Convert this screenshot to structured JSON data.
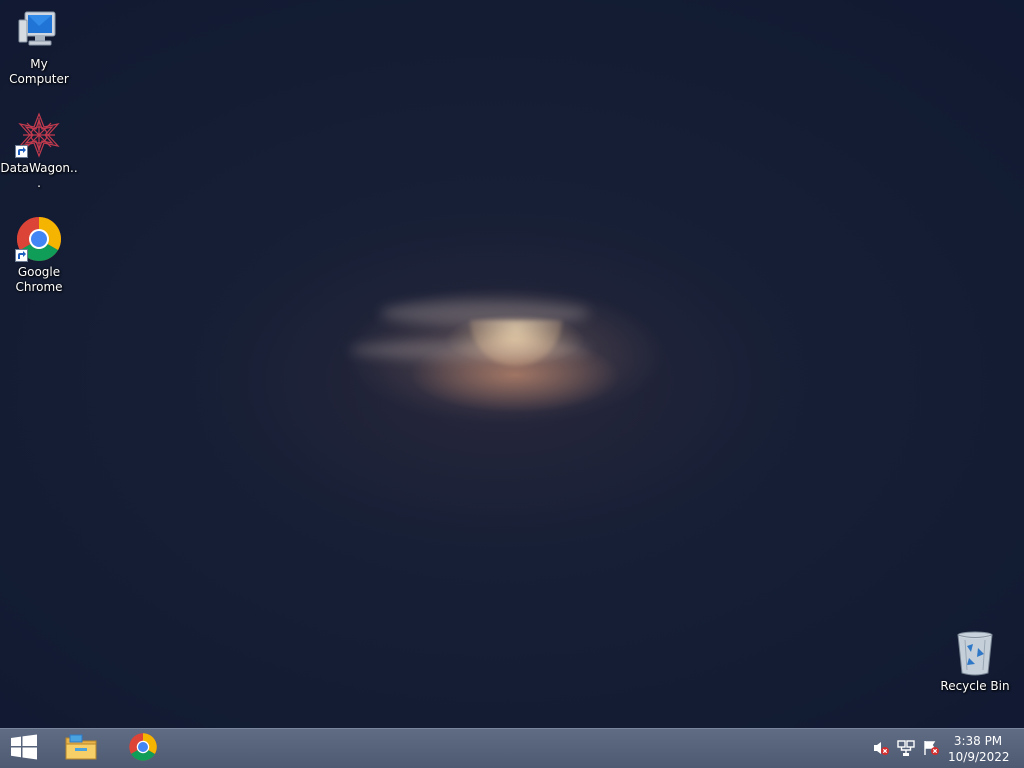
{
  "desktop": {
    "icons": [
      {
        "label": "My Computer",
        "icon": "computer-icon"
      },
      {
        "label": "DataWagon...",
        "icon": "datawagon-icon"
      },
      {
        "label": "Google Chrome",
        "icon": "chrome-icon"
      },
      {
        "label": "Recycle Bin",
        "icon": "recycle-bin-icon"
      }
    ]
  },
  "taskbar": {
    "start_icon": "windows-logo-icon",
    "pinned": [
      {
        "icon": "file-explorer-icon"
      },
      {
        "icon": "chrome-icon"
      }
    ],
    "tray": {
      "icons": [
        "volume-muted-icon",
        "network-icon",
        "action-center-icon"
      ],
      "time": "3:38 PM",
      "date": "10/9/2022"
    }
  }
}
